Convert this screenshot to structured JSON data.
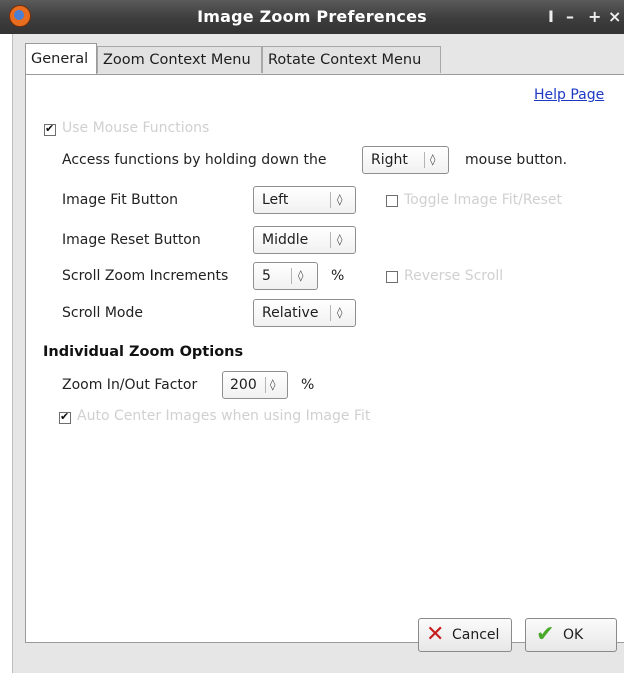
{
  "window": {
    "title": "Image Zoom Preferences",
    "controls": {
      "pin": "I",
      "minimize": "–",
      "maximize": "+",
      "close": "×"
    }
  },
  "tabs": [
    {
      "label": "General",
      "active": true
    },
    {
      "label": "Zoom Context Menu",
      "active": false
    },
    {
      "label": "Rotate Context Menu",
      "active": false
    }
  ],
  "general": {
    "help_link": "Help Page",
    "use_mouse_functions": {
      "label": "Use Mouse Functions",
      "checked": true
    },
    "access_functions": {
      "prefix": "Access functions by holding down the",
      "value": "Right",
      "suffix": "mouse button."
    },
    "image_fit_button": {
      "label": "Image Fit Button",
      "value": "Left"
    },
    "toggle_image_fit": {
      "label": "Toggle Image Fit/Reset",
      "checked": false
    },
    "image_reset_button": {
      "label": "Image Reset Button",
      "value": "Middle"
    },
    "scroll_zoom_increments": {
      "label": "Scroll Zoom Increments",
      "value": "5",
      "unit": "%"
    },
    "reverse_scroll": {
      "label": "Reverse Scroll",
      "checked": false
    },
    "scroll_mode": {
      "label": "Scroll Mode",
      "value": "Relative"
    },
    "individual_zoom": {
      "title": "Individual Zoom Options",
      "factor_label": "Zoom In/Out Factor",
      "factor_value": "200",
      "factor_unit": "%",
      "auto_center": {
        "label": "Auto Center Images when using Image Fit",
        "checked": true
      }
    }
  },
  "buttons": {
    "cancel": "Cancel",
    "ok": "OK"
  }
}
